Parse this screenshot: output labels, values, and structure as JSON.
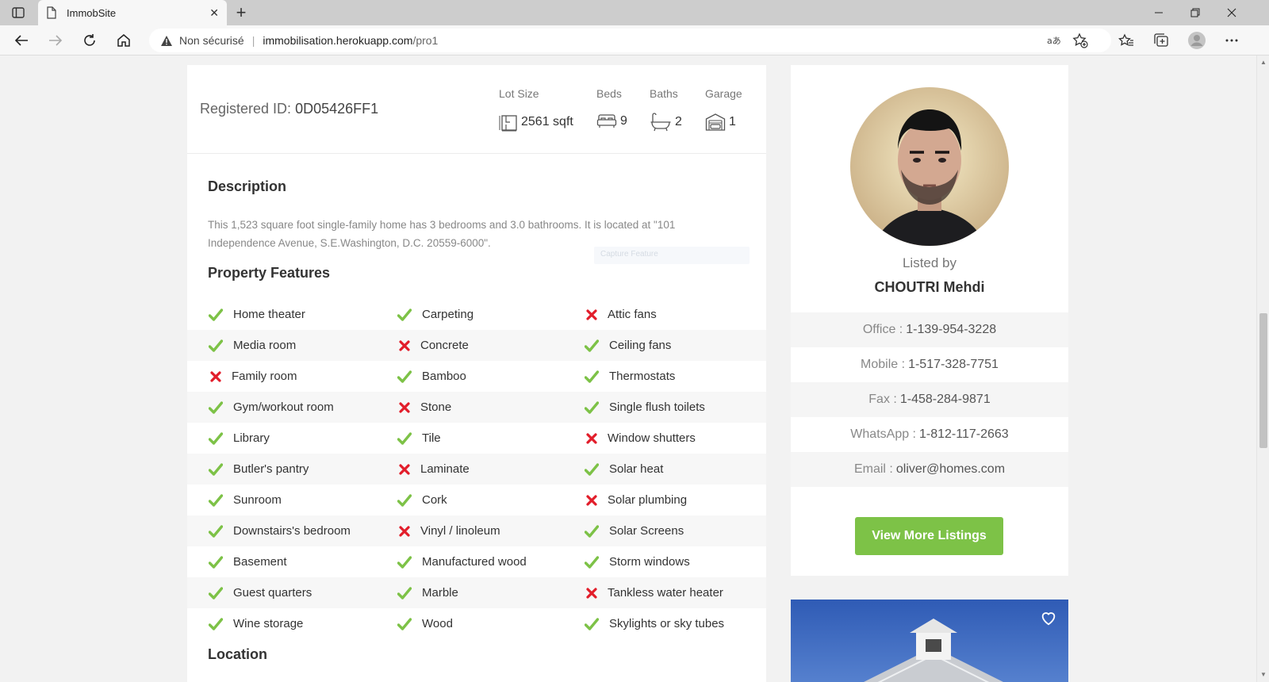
{
  "browser": {
    "tab_title": "ImmobSite",
    "tab_close": "✕",
    "new_tab": "+",
    "address": {
      "security_label": "Non sécurisé",
      "separator": "|",
      "host": "immobilisation.herokuapp.com",
      "path": "/pro1"
    },
    "icons": [
      "window-menu-icon",
      "doc-icon",
      "back-icon",
      "forward-icon",
      "reload-icon",
      "home-icon",
      "warning-icon",
      "read-aloud-icon",
      "favorite-add-icon",
      "favorites-icon",
      "collections-icon",
      "profile-icon",
      "more-icon"
    ]
  },
  "summary": {
    "registered_label": "Registered ID: ",
    "registered_id": "0D05426FF1",
    "stats": [
      {
        "label": "Lot Size",
        "value": "2561 sqft",
        "icon": "lot-size-icon"
      },
      {
        "label": "Beds",
        "value": "9",
        "icon": "bed-icon"
      },
      {
        "label": "Baths",
        "value": "2",
        "icon": "bath-icon"
      },
      {
        "label": "Garage",
        "value": "1",
        "icon": "garage-icon"
      }
    ]
  },
  "description": {
    "title": "Description",
    "text": "This 1,523 square foot single-family home has 3 bedrooms and 3.0 bathrooms. It is located at \"101 Independence Avenue, S.E.Washington, D.C. 20559-6000\".",
    "ghost_text": "Capture Feature"
  },
  "features": {
    "title": "Property Features",
    "rows": [
      [
        {
          "label": "Home theater",
          "ok": true
        },
        {
          "label": "Carpeting",
          "ok": true
        },
        {
          "label": "Attic fans",
          "ok": false
        }
      ],
      [
        {
          "label": "Media room",
          "ok": true
        },
        {
          "label": "Concrete",
          "ok": false
        },
        {
          "label": "Ceiling fans",
          "ok": true
        }
      ],
      [
        {
          "label": "Family room",
          "ok": false
        },
        {
          "label": "Bamboo",
          "ok": true
        },
        {
          "label": "Thermostats",
          "ok": true
        }
      ],
      [
        {
          "label": "Gym/workout room",
          "ok": true
        },
        {
          "label": "Stone",
          "ok": false
        },
        {
          "label": "Single flush toilets",
          "ok": true
        }
      ],
      [
        {
          "label": "Library",
          "ok": true
        },
        {
          "label": "Tile",
          "ok": true
        },
        {
          "label": "Window shutters",
          "ok": false
        }
      ],
      [
        {
          "label": "Butler's pantry",
          "ok": true
        },
        {
          "label": "Laminate",
          "ok": false
        },
        {
          "label": "Solar heat",
          "ok": true
        }
      ],
      [
        {
          "label": "Sunroom",
          "ok": true
        },
        {
          "label": "Cork",
          "ok": true
        },
        {
          "label": "Solar plumbing",
          "ok": false
        }
      ],
      [
        {
          "label": "Downstairs's bedroom",
          "ok": true
        },
        {
          "label": "Vinyl / linoleum",
          "ok": false
        },
        {
          "label": "Solar Screens",
          "ok": true
        }
      ],
      [
        {
          "label": "Basement",
          "ok": true
        },
        {
          "label": "Manufactured wood",
          "ok": true
        },
        {
          "label": "Storm windows",
          "ok": true
        }
      ],
      [
        {
          "label": "Guest quarters",
          "ok": true
        },
        {
          "label": "Marble",
          "ok": true
        },
        {
          "label": "Tankless water heater",
          "ok": false
        }
      ],
      [
        {
          "label": "Wine storage",
          "ok": true
        },
        {
          "label": "Wood",
          "ok": true
        },
        {
          "label": "Skylights or sky tubes",
          "ok": true
        }
      ]
    ]
  },
  "location": {
    "title": "Location"
  },
  "agent": {
    "listed_by": "Listed by",
    "name": "CHOUTRI Mehdi",
    "contacts": [
      {
        "label": "Office :",
        "value": "1-139-954-3228"
      },
      {
        "label": "Mobile :",
        "value": "1-517-328-7751"
      },
      {
        "label": "Fax :",
        "value": "1-458-284-9871"
      },
      {
        "label": "WhatsApp :",
        "value": "1-812-117-2663"
      },
      {
        "label": "Email :",
        "value": "oliver@homes.com"
      }
    ],
    "button": "View More Listings"
  },
  "colors": {
    "check": "#7dc247",
    "cross": "#e21d2a",
    "button": "#7dc247"
  }
}
